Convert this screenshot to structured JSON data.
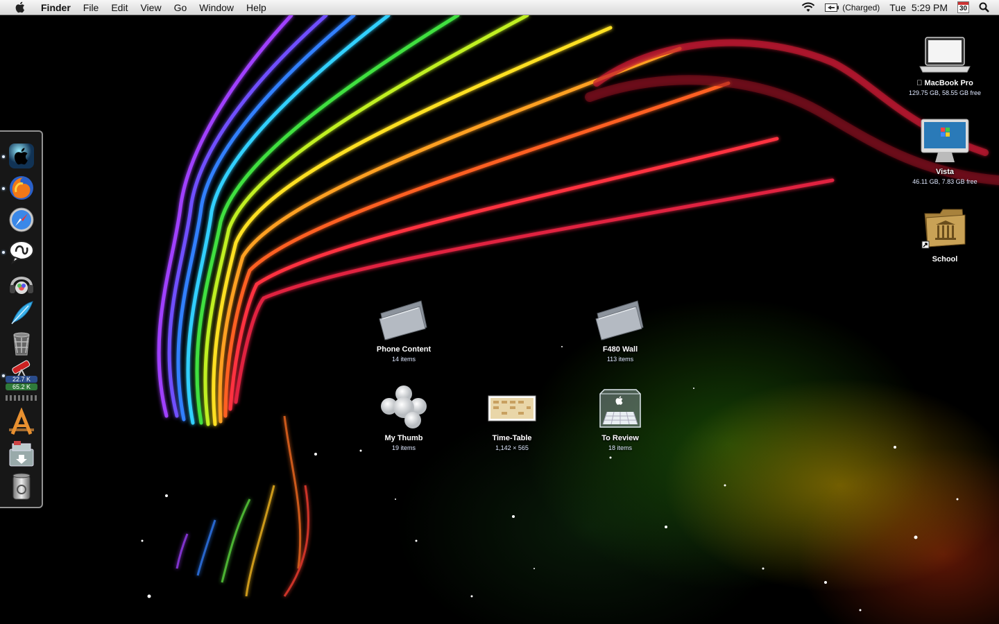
{
  "menubar": {
    "app_name": "Finder",
    "menus": [
      "File",
      "Edit",
      "View",
      "Go",
      "Window",
      "Help"
    ],
    "battery_status": "(Charged)",
    "day": "Tue",
    "time": "5:29 PM",
    "calendar_day": "30",
    "icons": {
      "apple": "apple-logo-icon",
      "wifi": "wifi-icon",
      "battery": "battery-icon",
      "spotlight": "spotlight-search-icon"
    }
  },
  "dock": {
    "items": [
      {
        "name": "apple-app",
        "icon": "apple-sphere-icon",
        "running": true
      },
      {
        "name": "firefox",
        "icon": "firefox-icon",
        "running": true
      },
      {
        "name": "safari",
        "icon": "safari-compass-icon",
        "running": false
      },
      {
        "name": "chat-app",
        "icon": "chat-bubble-icon",
        "running": true
      },
      {
        "name": "itunes",
        "icon": "headphones-music-icon",
        "running": false
      },
      {
        "name": "feather-app",
        "icon": "feather-icon",
        "running": false
      },
      {
        "name": "trash-app",
        "icon": "waste-basket-icon",
        "running": false
      },
      {
        "name": "network-monitor",
        "icon": "telescope-icon",
        "running": true
      }
    ],
    "net_upload": "22.7 K",
    "net_download": "65.2 K",
    "bottom_items": [
      {
        "name": "applications",
        "icon": "applications-a-icon"
      },
      {
        "name": "downloads",
        "icon": "downloads-tray-icon"
      },
      {
        "name": "trash",
        "icon": "trash-can-icon"
      }
    ]
  },
  "desktop": {
    "drives": [
      {
        "label": "MacBook Pro",
        "sub": "129.75 GB, 58.55 GB free",
        "icon": "laptop-icon"
      },
      {
        "label": "Vista",
        "sub": "46.11 GB, 7.83 GB free",
        "icon": "imac-windows-icon"
      },
      {
        "label": "School",
        "sub": "",
        "icon": "school-folder-alias-icon"
      }
    ],
    "items": [
      {
        "label": "Phone Content",
        "sub": "14 items",
        "icon": "folder-icon"
      },
      {
        "label": "F480 Wall",
        "sub": "113 items",
        "icon": "folder-icon"
      },
      {
        "label": "My Thumb",
        "sub": "19 items",
        "icon": "usb-drive-icon"
      },
      {
        "label": "Time-Table",
        "sub": "1,142 × 565",
        "icon": "image-file-icon"
      },
      {
        "label": "To Review",
        "sub": "18 items",
        "icon": "glass-box-icon"
      }
    ]
  },
  "colors": {
    "menubar_top": "#f6f6f6",
    "menubar_bottom": "#d9d9d9",
    "desktop_bg": "#000000"
  }
}
